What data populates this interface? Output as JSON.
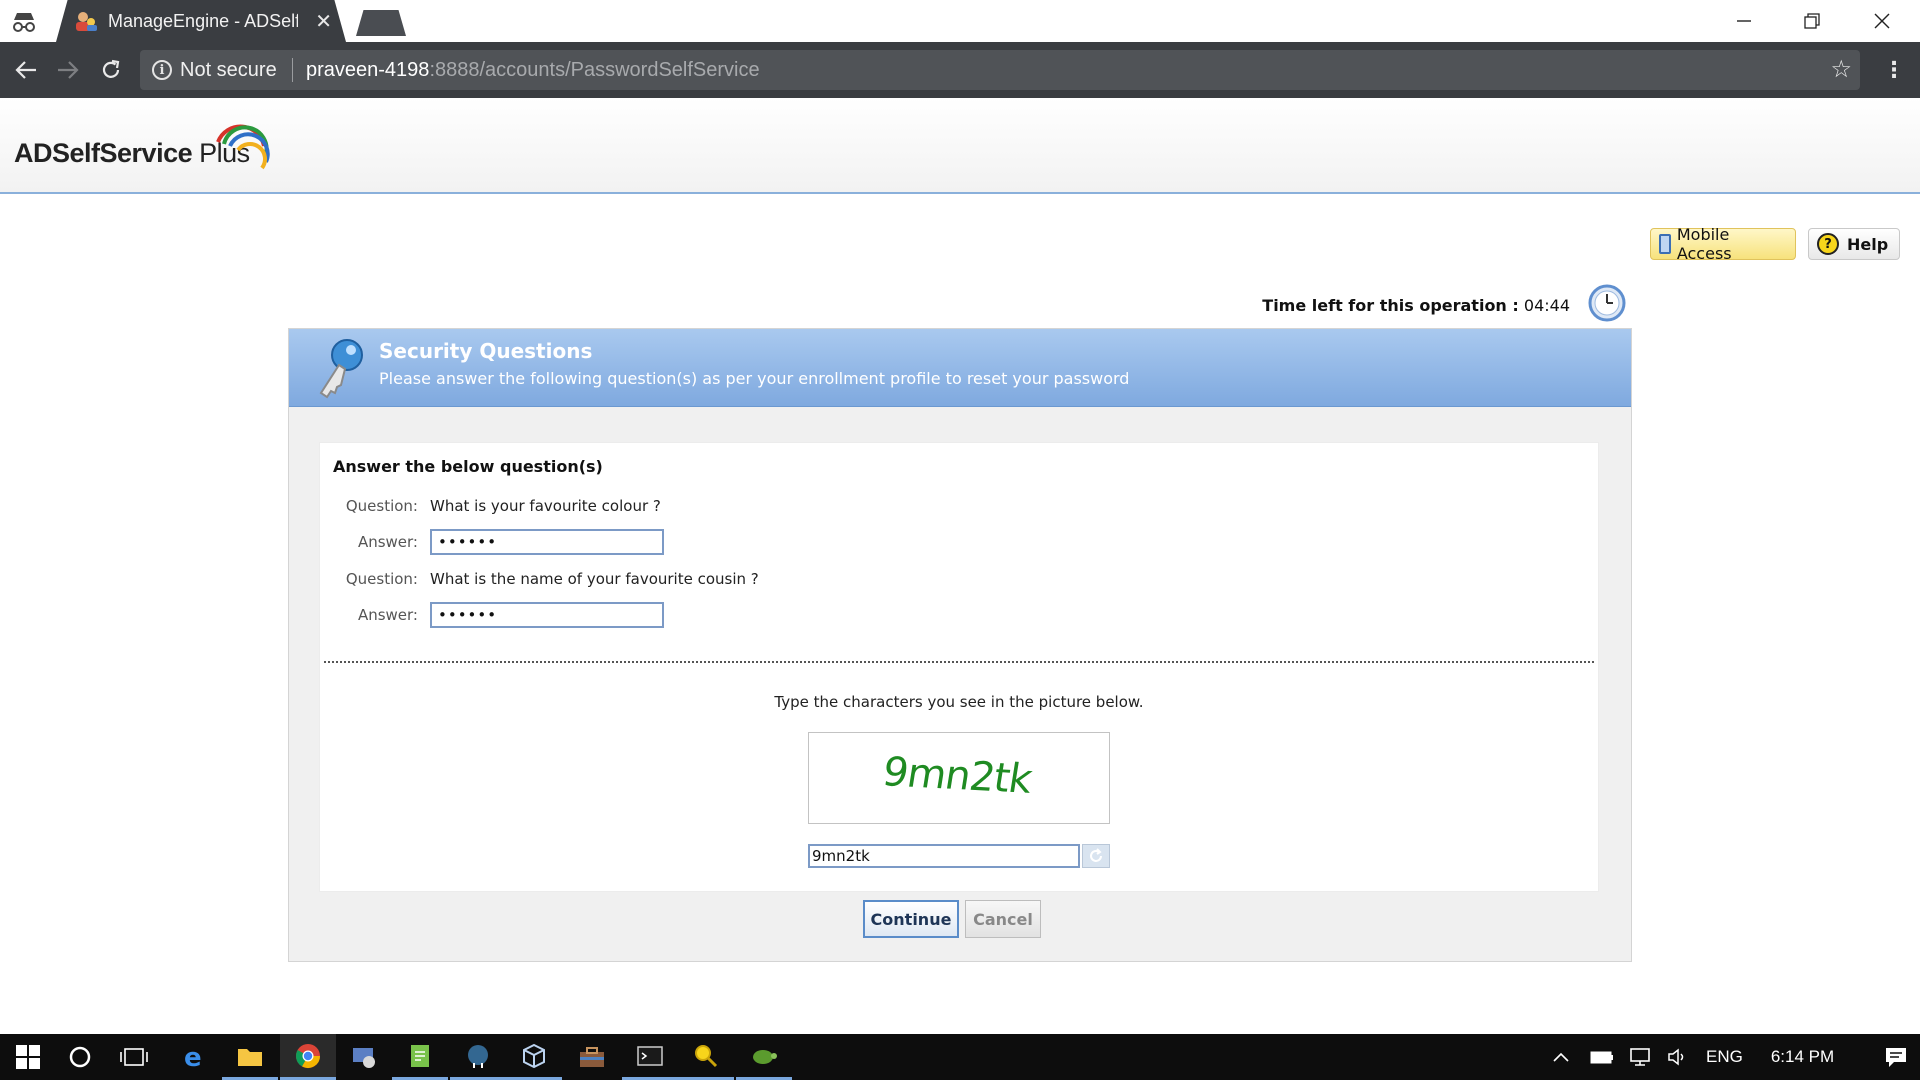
{
  "browser": {
    "tab_title": "ManageEngine - ADSelfService Plus",
    "tab_close": "✕",
    "security_label": "Not secure",
    "url_host": "praveen-4198",
    "url_rest": ":8888/accounts/PasswordSelfService"
  },
  "header": {
    "logo_main": "ADSelfService ",
    "logo_plus": "Plus"
  },
  "top_buttons": {
    "mobile_access": "Mobile Access",
    "help": "Help",
    "help_icon_glyph": "?"
  },
  "timer": {
    "label": "Time left for this operation :",
    "value": "04:44"
  },
  "panel": {
    "title": "Security Questions",
    "subtitle": "Please answer the following question(s) as per your enrollment profile to reset your password"
  },
  "questions": {
    "section_title": "Answer the below question(s)",
    "question_label": "Question:",
    "answer_label": "Answer:",
    "items": [
      {
        "question": "What is your favourite colour ?",
        "answer_masked": "••••••"
      },
      {
        "question": "What is the name of your favourite cousin ?",
        "answer_masked": "••••••"
      }
    ]
  },
  "captcha": {
    "prompt": "Type the characters you see in the picture below.",
    "image_text": "9mn2tk",
    "input_value": "9mn2tk"
  },
  "actions": {
    "continue": "Continue",
    "cancel": "Cancel"
  },
  "taskbar": {
    "language": "ENG",
    "clock": "6:14 PM"
  }
}
